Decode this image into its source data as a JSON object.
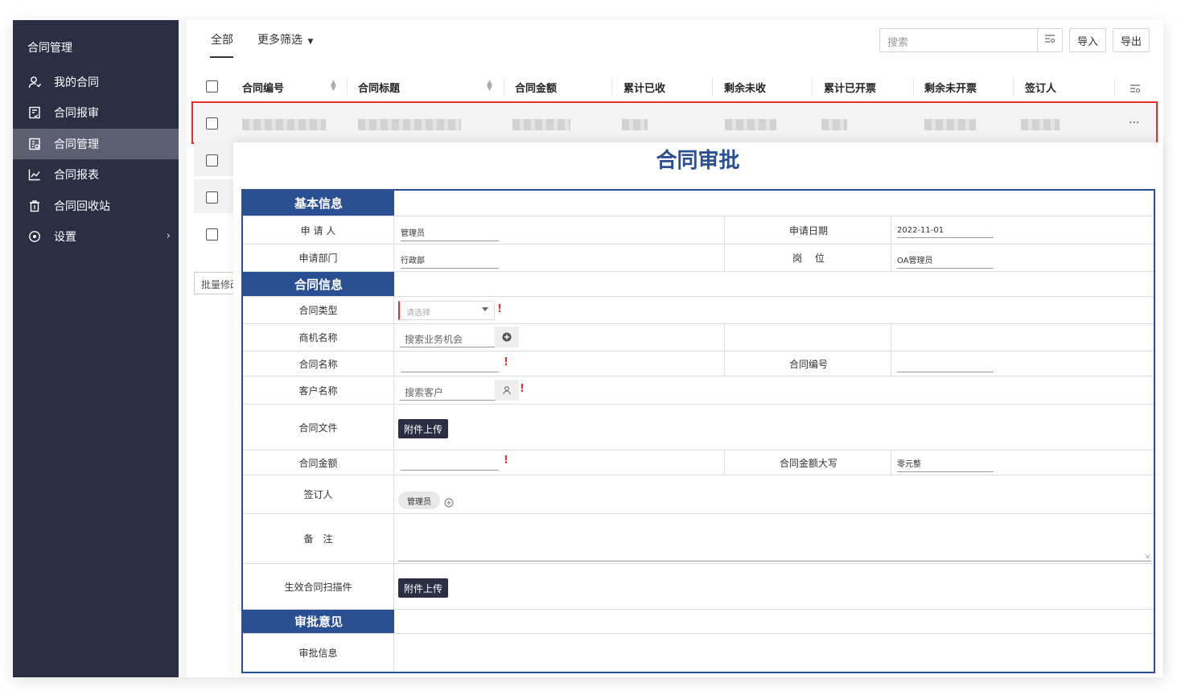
{
  "sidebar": {
    "title": "合同管理",
    "items": [
      {
        "label": "我的合同",
        "icon": "user-icon"
      },
      {
        "label": "合同报审",
        "icon": "document-check-icon"
      },
      {
        "label": "合同管理",
        "icon": "contract-manage-icon"
      },
      {
        "label": "合同报表",
        "icon": "line-chart-icon"
      },
      {
        "label": "合同回收站",
        "icon": "trash-icon"
      },
      {
        "label": "设置",
        "icon": "settings-icon"
      }
    ],
    "active_index": 2
  },
  "toolbar": {
    "tabs": [
      "全部",
      "更多筛选"
    ],
    "search_placeholder": "搜索",
    "import_label": "导入",
    "export_label": "导出"
  },
  "table": {
    "columns": [
      "合同编号",
      "合同标题",
      "合同金额",
      "累计已收",
      "剩余未收",
      "累计已开票",
      "剩余未开票",
      "签订人"
    ],
    "row_more": "...",
    "batch_label": "批量修改"
  },
  "form": {
    "title": "合同审批",
    "sections": {
      "basic": "基本信息",
      "contract": "合同信息",
      "approval": "审批意见"
    },
    "labels": {
      "applicant": "申 请 人",
      "apply_date": "申请日期",
      "department": "申请部门",
      "position": "岗　 位",
      "contract_type": "合同类型",
      "opportunity": "商机名称",
      "contract_name": "合同名称",
      "contract_no": "合同编号",
      "customer": "客户名称",
      "contract_file": "合同文件",
      "amount": "合同金额",
      "amount_upper": "合同金额大写",
      "signer": "签订人",
      "remark": "备　注",
      "scan": "生效合同扫描件",
      "approval_info": "审批信息"
    },
    "values": {
      "applicant": "管理员",
      "apply_date": "2022-11-01",
      "department": "行政部",
      "position": "OA管理员",
      "contract_type_placeholder": "请选择",
      "opportunity_placeholder": "搜索业务机会",
      "customer_placeholder": "搜索客户",
      "amount_upper": "零元整",
      "signer": "管理员"
    },
    "upload_label": "附件上传",
    "required_mark": "!"
  },
  "colors": {
    "sidebar_bg": "#2b2f44",
    "form_blue": "#2b4f93",
    "highlight_red": "#e03131"
  }
}
